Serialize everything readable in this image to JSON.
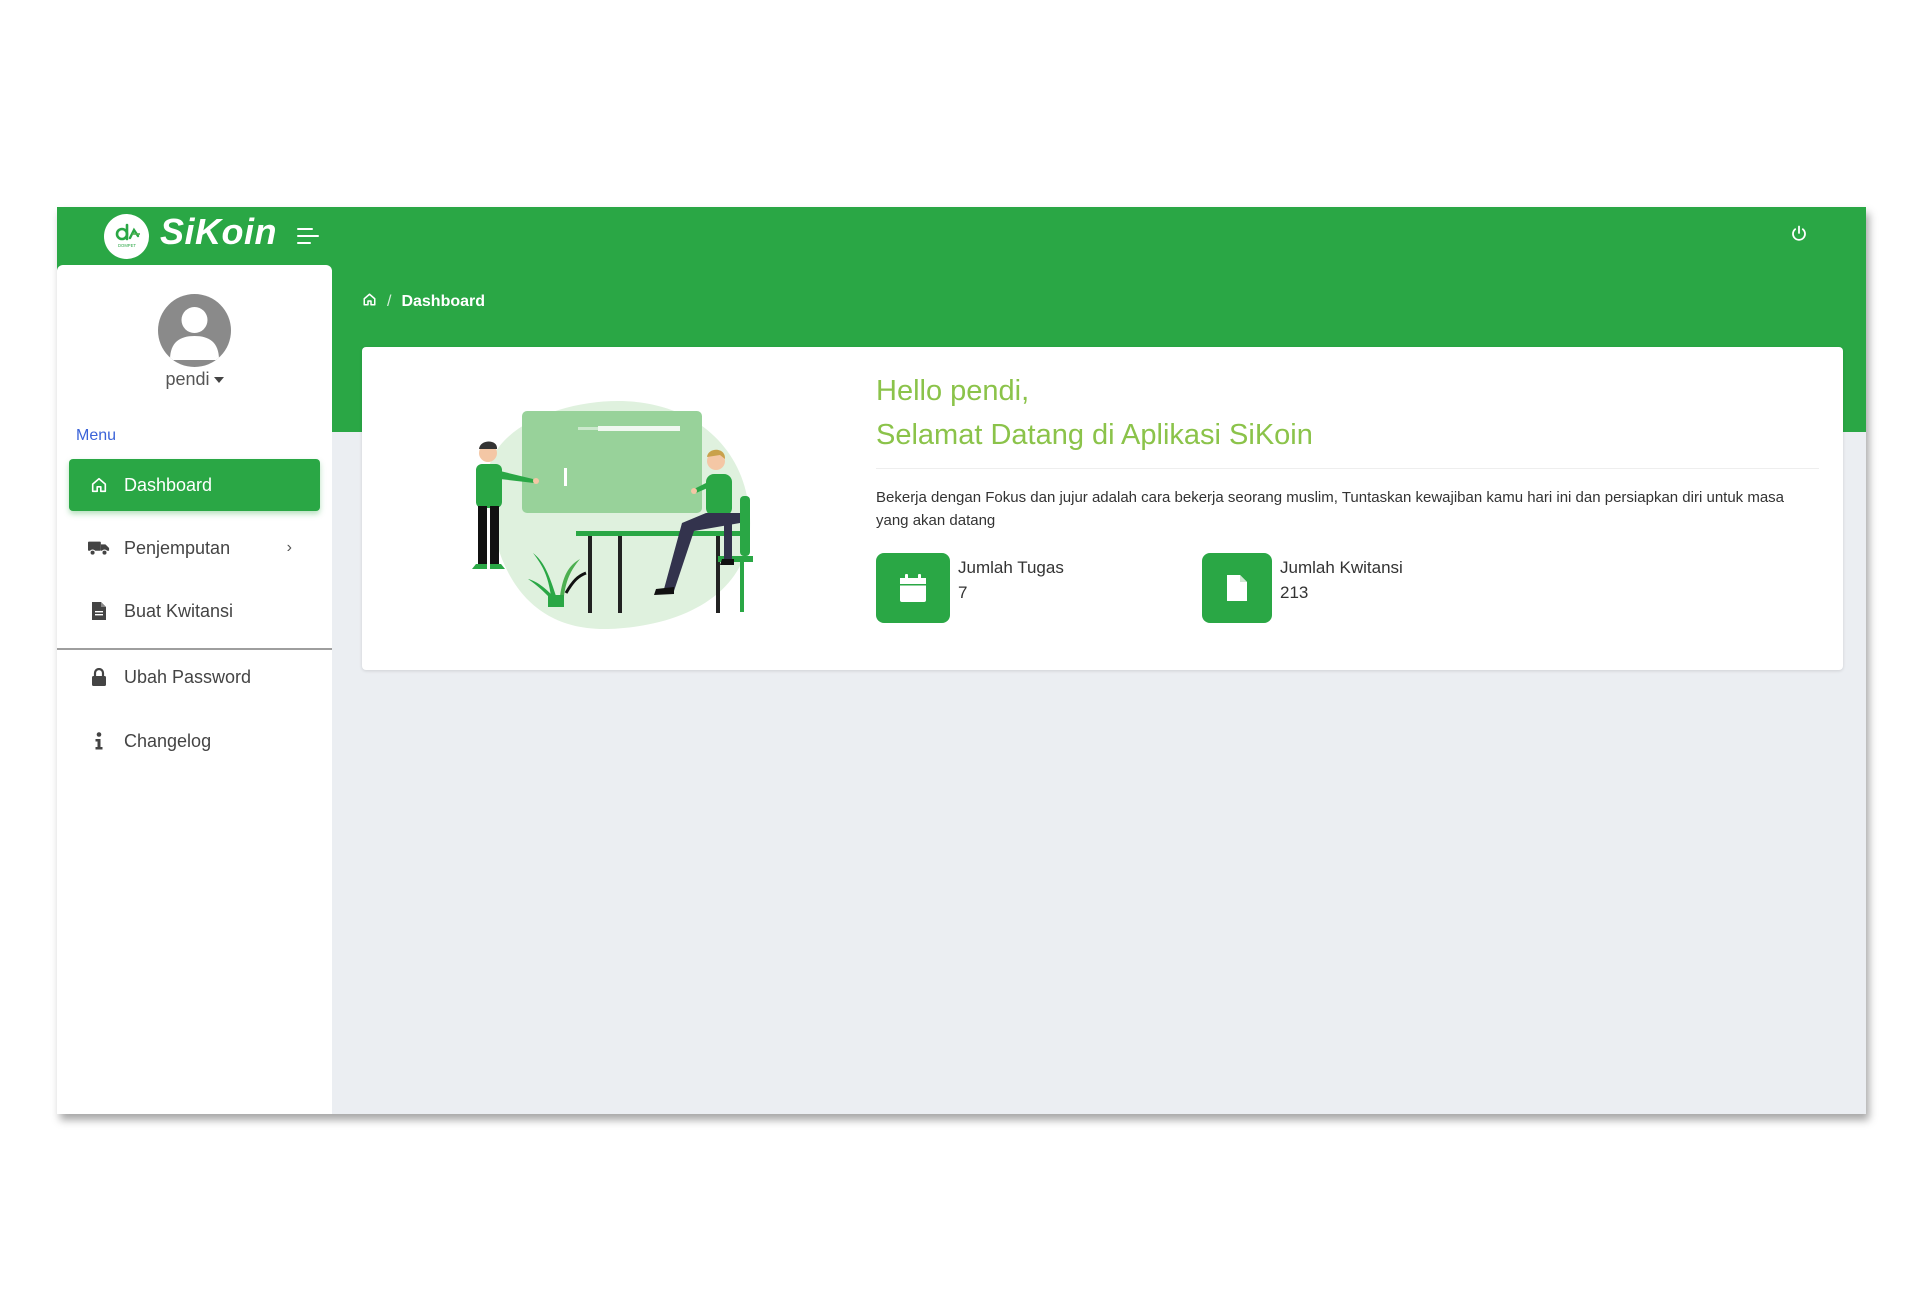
{
  "app": {
    "brand": "SiKoin",
    "logo_text": "DOMPET"
  },
  "user": {
    "name": "pendi"
  },
  "sidebar": {
    "menu_heading": "Menu",
    "items": [
      {
        "label": "Dashboard",
        "icon": "home-icon",
        "active": true
      },
      {
        "label": "Penjemputan",
        "icon": "truck-icon",
        "has_submenu": true
      },
      {
        "label": "Buat Kwitansi",
        "icon": "file-icon"
      },
      {
        "label": "Ubah Password",
        "icon": "lock-icon"
      },
      {
        "label": "Changelog",
        "icon": "info-icon"
      }
    ]
  },
  "breadcrumb": {
    "current": "Dashboard",
    "separator": "/"
  },
  "welcome": {
    "line1": "Hello pendi,",
    "line2": "Selamat Datang di Aplikasi SiKoin",
    "description": "Bekerja dengan Fokus dan jujur adalah cara bekerja seorang muslim, Tuntaskan kewajiban kamu hari ini dan persiapkan diri untuk masa yang akan datang"
  },
  "stats": [
    {
      "label": "Jumlah Tugas",
      "value": "7",
      "icon": "calendar-icon"
    },
    {
      "label": "Jumlah Kwitansi",
      "value": "213",
      "icon": "file-icon"
    }
  ],
  "colors": {
    "primary": "#2aa745",
    "greeting": "#8bc34a",
    "menu_heading": "#3b63d8",
    "background": "#ebeef2"
  }
}
